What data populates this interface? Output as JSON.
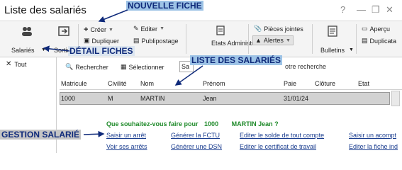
{
  "window": {
    "title": "Liste des salariés"
  },
  "ribbon": {
    "salaries_label": "Salariés",
    "sorties_label": "Sortie",
    "creer_label": "Créer",
    "editer_label": "Editer",
    "dupliquer_label": "Dupliquer",
    "publipostage_label": "Publipostage",
    "etats_label": "Etats Administratifs",
    "pieces_label": "Pièces jointes",
    "alertes_label": "Alertes",
    "bulletins_label": "Bulletins",
    "apercu_label": "Aperçu",
    "duplicata_label": "Duplicata"
  },
  "sidebar": {
    "tout_label": "Tout"
  },
  "toolbar": {
    "rechercher_label": "Rechercher",
    "selectionner_label": "Sélectionner",
    "search_value": "Sa",
    "search_placeholder_tail": "otre recherche"
  },
  "table": {
    "columns": [
      "Matricule",
      "Civilité",
      "Nom",
      "Prénom",
      "Paie",
      "Clôture",
      "Etat"
    ],
    "rows": [
      {
        "matricule": "1000",
        "civilite": "M",
        "nom": "MARTIN",
        "prenom": "Jean",
        "paie": "31/01/24",
        "cloture": "",
        "etat": ""
      }
    ]
  },
  "question": {
    "prefix": "Que souhaitez-vous faire pour",
    "matricule": "1000",
    "name": "MARTIN Jean ?"
  },
  "links": [
    "Saisir un arrêt",
    "Générer la FCTU",
    "Editer le solde de tout compte",
    "Saisir un acompt",
    "Voir ses arrêts",
    "Générer une DSN",
    "Editer le certificat de travail",
    "Editer la fiche ind"
  ],
  "callouts": {
    "nouvelle_fiche": "NOUVELLE FICHE",
    "detail_fiches": "DÉTAIL FICHES",
    "liste_salaries": "LISTE DES SALARIÉS",
    "gestion_salarie": "GESTION SALARIÉ"
  },
  "colors": {
    "callout_text": "#0f2a7a",
    "callout_blue_bg": "#9dc3e6",
    "green_text": "#1f8a2a",
    "link": "#1a3d8f",
    "selected_row": "#d2d2d2"
  }
}
